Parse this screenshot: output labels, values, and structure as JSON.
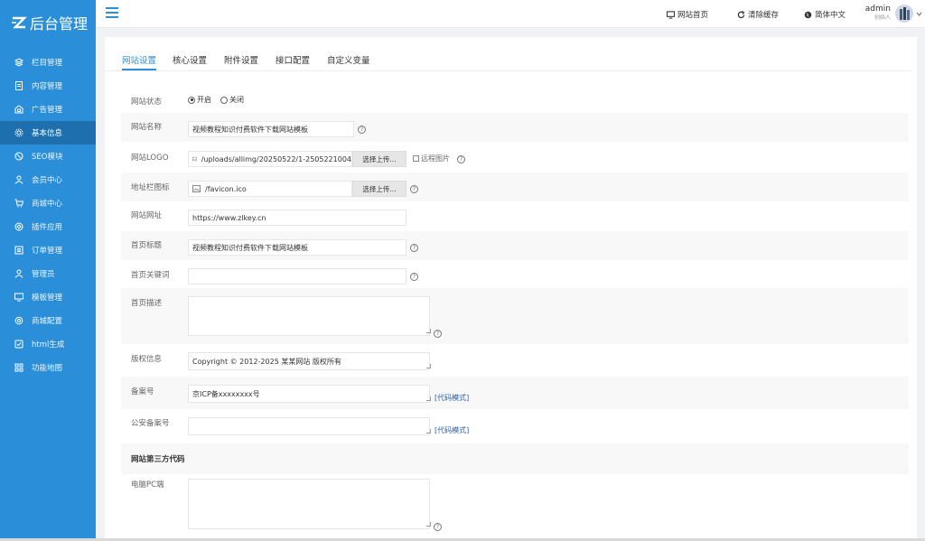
{
  "sidebar": {
    "logo_text": "后台管理",
    "items": [
      {
        "label": "栏目管理",
        "icon": "layers-icon"
      },
      {
        "label": "内容管理",
        "icon": "document-icon"
      },
      {
        "label": "广告管理",
        "icon": "ad-icon"
      },
      {
        "label": "基本信息",
        "icon": "gear-icon",
        "active": true
      },
      {
        "label": "SEO模块",
        "icon": "seo-icon"
      },
      {
        "label": "会员中心",
        "icon": "user-icon"
      },
      {
        "label": "商城中心",
        "icon": "cart-icon"
      },
      {
        "label": "插件应用",
        "icon": "plugin-icon"
      },
      {
        "label": "订单管理",
        "icon": "order-icon"
      },
      {
        "label": "管理员",
        "icon": "admin-icon"
      },
      {
        "label": "模板管理",
        "icon": "monitor-icon"
      },
      {
        "label": "商城配置",
        "icon": "settings-icon"
      },
      {
        "label": "html生成",
        "icon": "html-icon"
      },
      {
        "label": "功能地图",
        "icon": "grid-icon"
      }
    ]
  },
  "header": {
    "site_home": "网站首页",
    "clear_cache": "清除缓存",
    "language": "简体中文",
    "user_name": "admin",
    "user_role": "创始人"
  },
  "tabs": [
    "网站设置",
    "核心设置",
    "附件设置",
    "接口配置",
    "自定义变量"
  ],
  "form": {
    "status_label": "网站状态",
    "status_on": "开启",
    "status_off": "关闭",
    "site_name_label": "网站名称",
    "site_name_value": "视频教程知识付费软件下载网站模板",
    "logo_label": "网站LOGO",
    "logo_value": "/uploads/allimg/20250522/1-2505221004",
    "upload_label": "选择上传...",
    "remote_image_label": "远程图片",
    "favicon_label": "地址栏图标",
    "favicon_value": "/favicon.ico",
    "site_url_label": "网站网址",
    "site_url_value": "https://www.zlkey.cn",
    "home_title_label": "首页标题",
    "home_title_value": "视频教程知识付费软件下载网站模板",
    "home_keywords_label": "首页关键词",
    "home_keywords_value": "",
    "home_desc_label": "首页描述",
    "home_desc_value": "",
    "copyright_label": "版权信息",
    "copyright_value": "Copyright © 2012-2025 某某网站 版权所有",
    "icp_label": "备案号",
    "icp_value": "京ICP备xxxxxxxx号",
    "code_mode_label": "[代码模式]",
    "police_label": "公安备案号",
    "police_value": "",
    "third_party_title": "网站第三方代码",
    "pc_label": "电脑PC端",
    "pc_value": ""
  },
  "colors": {
    "sidebar_bg": "#2a8fd8",
    "sidebar_active": "#1d6fae",
    "accent": "#2a8fd8"
  }
}
